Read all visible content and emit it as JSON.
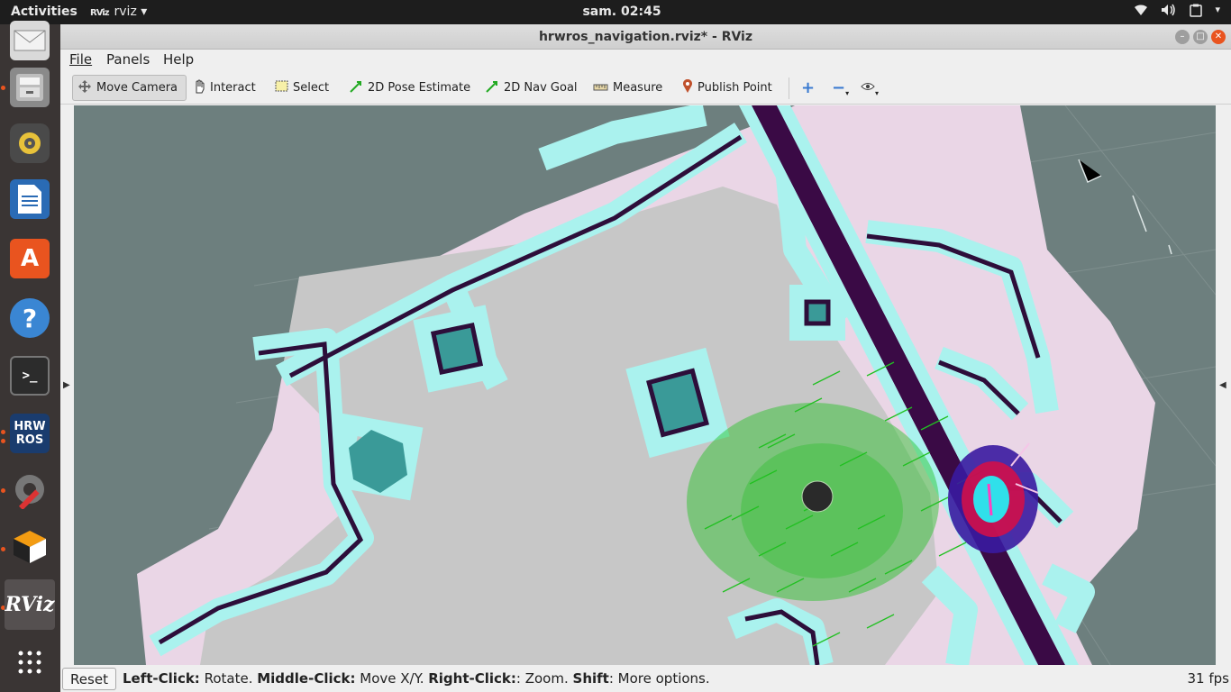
{
  "topbar": {
    "activities": "Activities",
    "app_menu_icon": "RViz",
    "app_menu": "rviz",
    "clock": "sam. 02:45",
    "tray_icons": [
      "wifi-icon",
      "volume-icon",
      "clipboard-icon",
      "power-icon"
    ]
  },
  "dock": {
    "items": [
      {
        "name": "dock-mail",
        "icon": "mail-icon"
      },
      {
        "name": "dock-files",
        "icon": "files-icon"
      },
      {
        "name": "dock-rhythmbox",
        "icon": "speaker-icon"
      },
      {
        "name": "dock-writer",
        "icon": "document-icon"
      },
      {
        "name": "dock-software",
        "icon": "software-store-icon",
        "label": "A"
      },
      {
        "name": "dock-help",
        "icon": "help-icon",
        "label": "?"
      },
      {
        "name": "dock-terminal",
        "icon": "terminal-icon",
        "label": ">_"
      },
      {
        "name": "dock-hrwros",
        "icon": "hrwros-icon",
        "label": "HRW\nROS"
      },
      {
        "name": "dock-settings",
        "icon": "settings-tools-icon"
      },
      {
        "name": "dock-package",
        "icon": "package-icon"
      },
      {
        "name": "dock-rviz",
        "icon": "rviz-icon",
        "label": "RViz"
      },
      {
        "name": "dock-app-grid",
        "icon": "app-grid-icon"
      }
    ]
  },
  "window": {
    "title": "hrwros_navigation.rviz* - RViz",
    "menu": {
      "file": "File",
      "panels": "Panels",
      "help": "Help"
    },
    "toolbar": {
      "move_camera": "Move Camera",
      "interact": "Interact",
      "select": "Select",
      "pose_estimate": "2D Pose Estimate",
      "nav_goal": "2D Nav Goal",
      "measure": "Measure",
      "publish_point": "Publish Point"
    },
    "status": {
      "reset": "Reset",
      "left_click": "Left-Click:",
      "left_action": " Rotate. ",
      "middle_click": "Middle-Click:",
      "middle_action": " Move X/Y. ",
      "right_click": "Right-Click:",
      "right_action": ": Zoom. ",
      "shift": "Shift",
      "shift_action": ": More options.",
      "fps": "31 fps"
    }
  },
  "colors": {
    "free_space": "#c9c9c9",
    "unknown": "#6d7f7e",
    "inflation_cyan": "#a8f0ec",
    "inflation_pink": "#f2cfe3",
    "obstacle": "#2d0e3a",
    "particles": "#22c022",
    "robot": "#2a2a2a"
  }
}
